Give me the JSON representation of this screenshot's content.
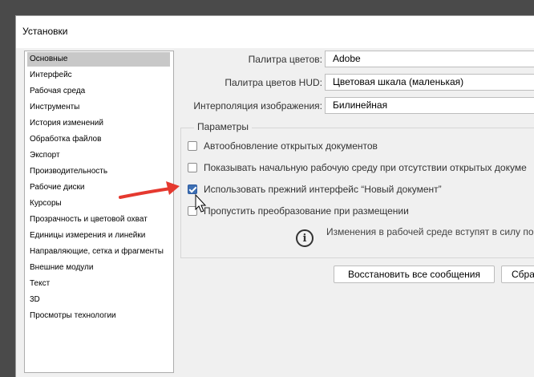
{
  "dialog": {
    "title": "Установки"
  },
  "sidebar": {
    "selected_index": 0,
    "items": [
      "Основные",
      "Интерфейс",
      "Рабочая среда",
      "Инструменты",
      "История изменений",
      "Обработка файлов",
      "Экспорт",
      "Производительность",
      "Рабочие диски",
      "Курсоры",
      "Прозрачность и цветовой охват",
      "Единицы измерения и линейки",
      "Направляющие, сетка и фрагменты",
      "Внешние модули",
      "Текст",
      "3D",
      "Просмотры технологии"
    ]
  },
  "settings": {
    "color_picker": {
      "label": "Палитра цветов:",
      "value": "Adobe"
    },
    "hud_picker": {
      "label": "Палитра цветов HUD:",
      "value": "Цветовая шкала (маленькая)"
    },
    "interpolation": {
      "label": "Интерполяция изображения:",
      "value": "Билинейная"
    }
  },
  "params": {
    "title": "Параметры",
    "options": [
      {
        "label": "Автообновление открытых документов",
        "checked": false
      },
      {
        "label": "Показывать начальную рабочую среду при отсутствии открытых докуме",
        "checked": false
      },
      {
        "label": "Использовать прежний интерфейс “Новый документ”",
        "checked": true
      },
      {
        "label": "Пропустить преобразование при размещении",
        "checked": false
      }
    ],
    "info": "Изменения в рабочей среде вступят в силу по"
  },
  "buttons": {
    "reset_messages": "Восстановить все сообщения",
    "second": "Сбра"
  },
  "colors": {
    "accent": "#3d6fb3",
    "arrow": "#e5392f"
  }
}
